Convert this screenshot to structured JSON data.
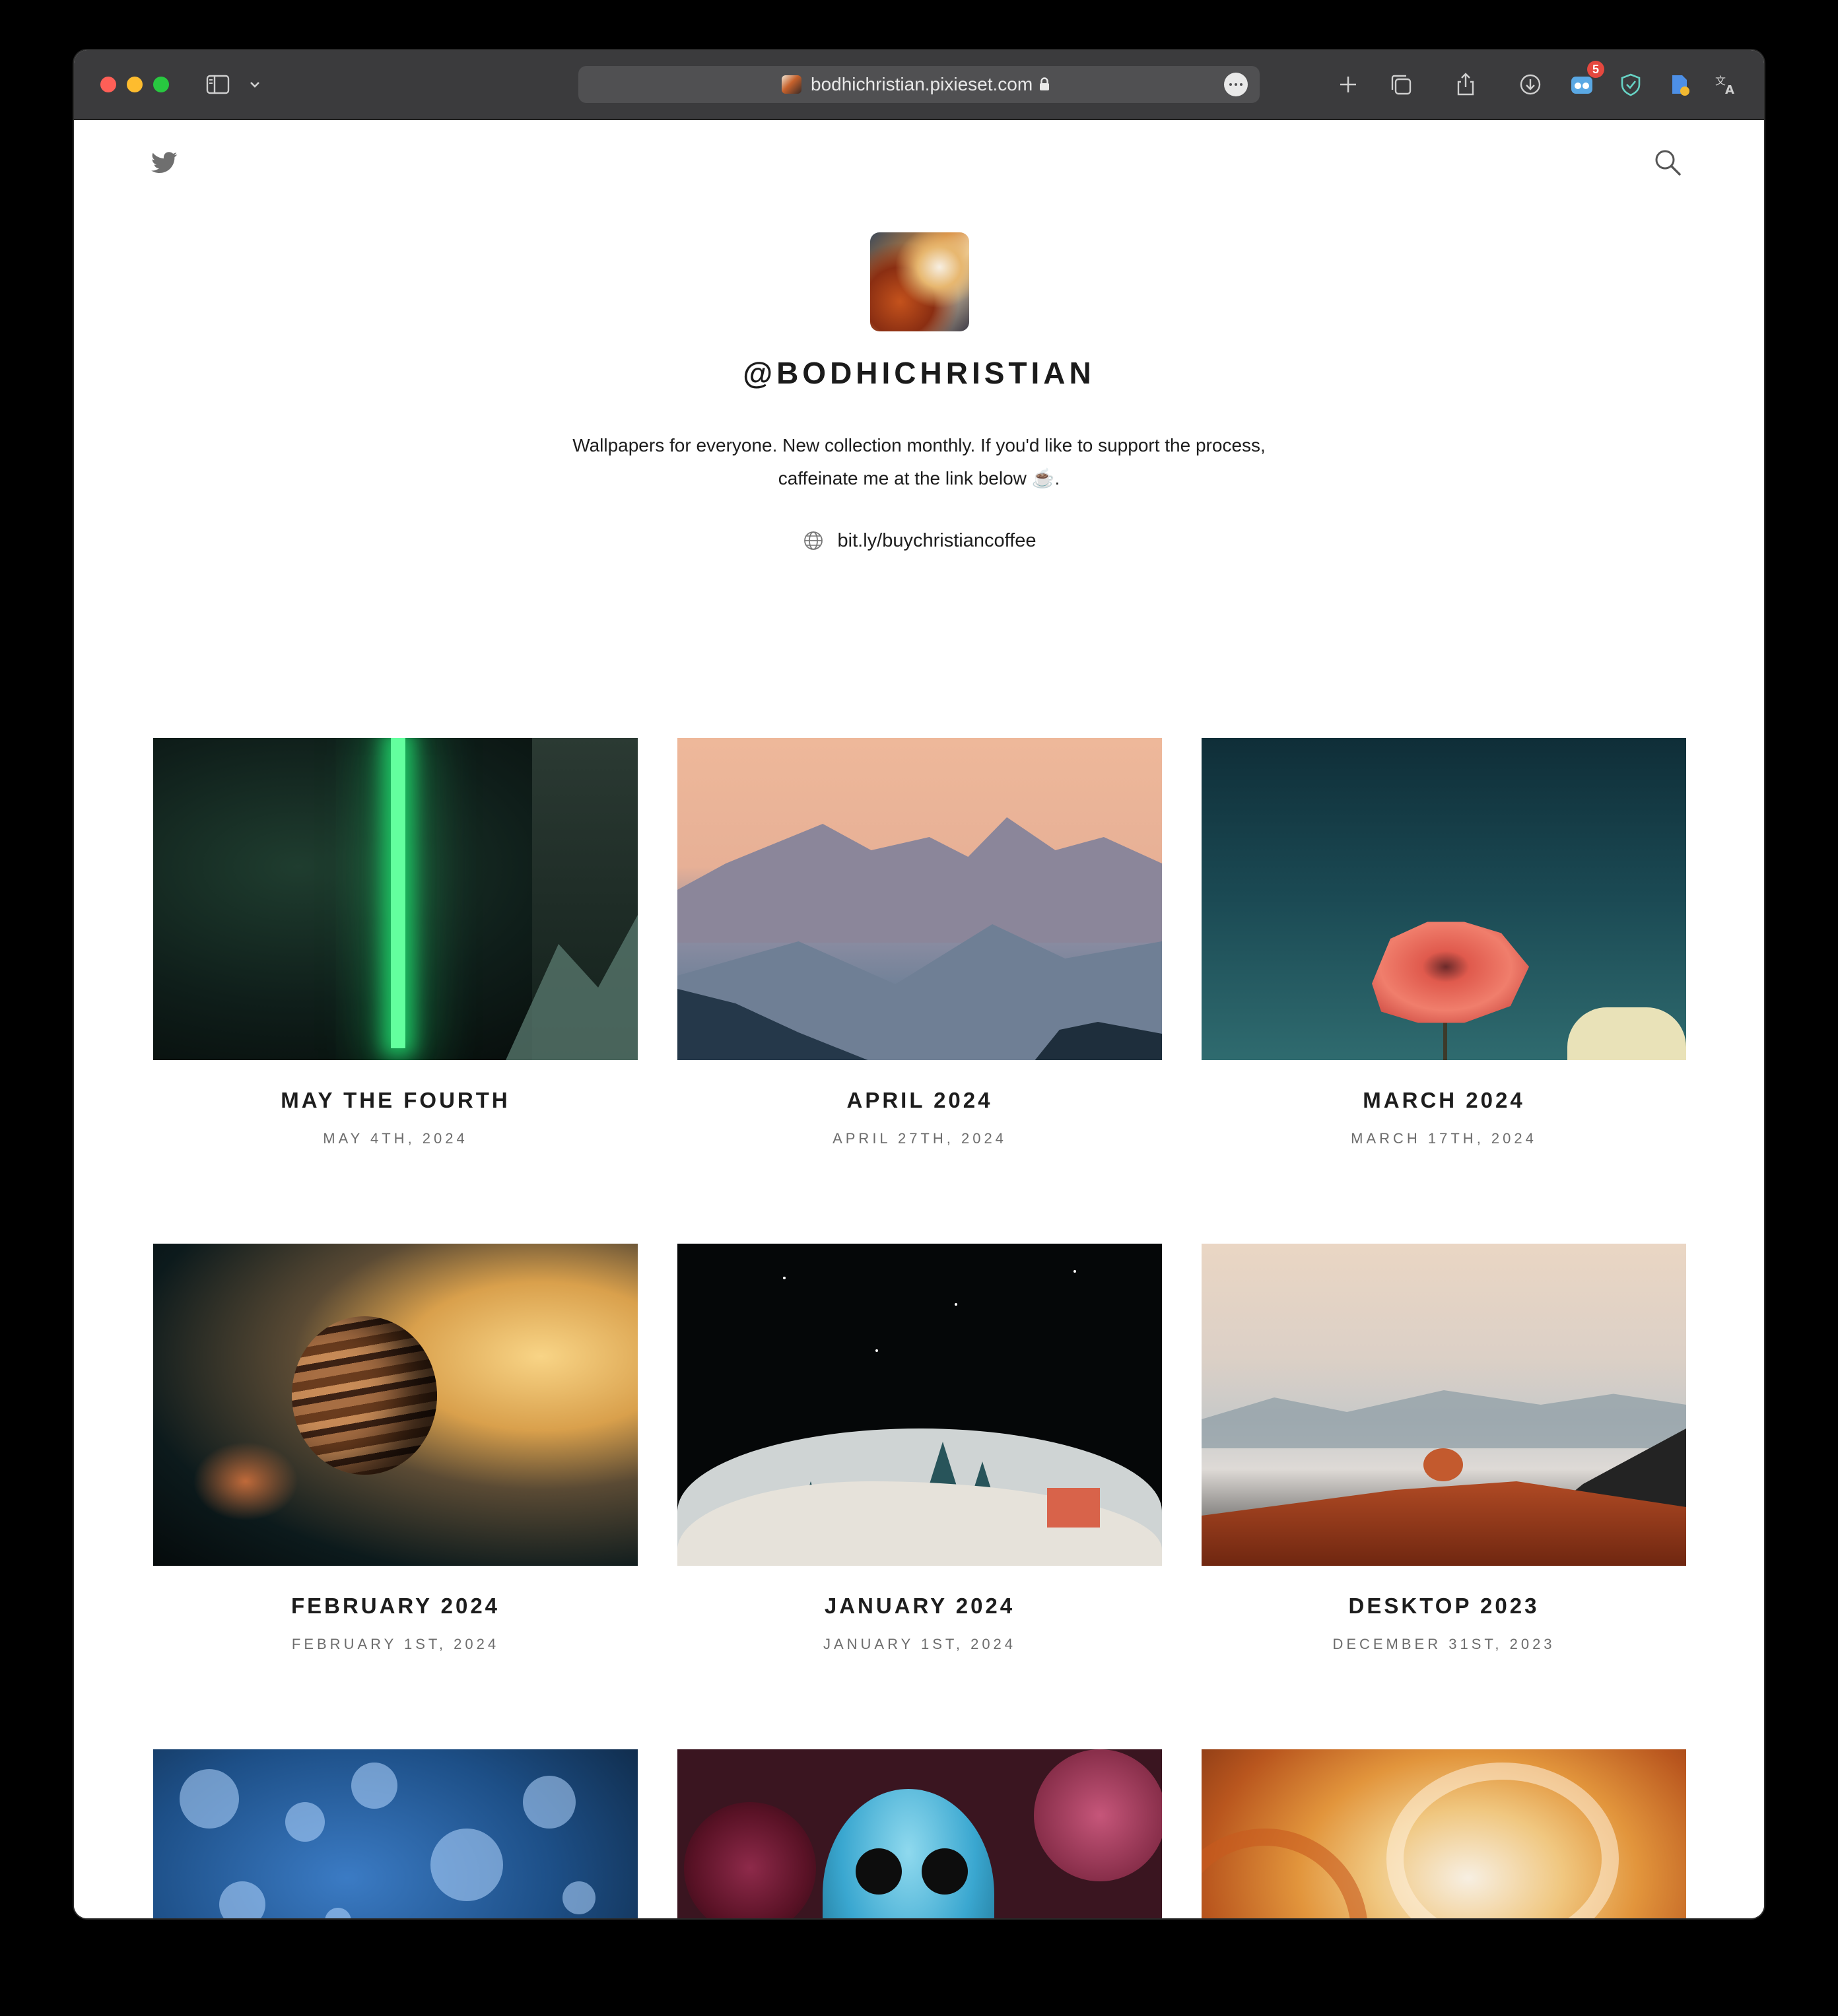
{
  "browser": {
    "url": "bodhichristian.pixieset.com",
    "notification_count": "5",
    "toolbar_icons": [
      "sidebar-icon",
      "chevron-down-icon",
      "plus-icon",
      "tabs-overview-icon",
      "share-icon",
      "download-icon",
      "extension-icon",
      "shield-check-icon",
      "extension2-icon",
      "translate-icon"
    ]
  },
  "header": {
    "left_icon": "twitter-icon",
    "right_icon": "search-icon"
  },
  "profile": {
    "name": "@BODHICHRISTIAN",
    "bio_line1": "Wallpapers for everyone. New collection monthly. If you'd like to support the process,",
    "bio_line2": "caffeinate me at the link below ☕.",
    "link": "bit.ly/buychristiancoffee"
  },
  "collections": [
    {
      "title": "MAY THE FOURTH",
      "date": "MAY 4TH, 2024"
    },
    {
      "title": "APRIL 2024",
      "date": "APRIL 27TH, 2024"
    },
    {
      "title": "MARCH 2024",
      "date": "MARCH 17TH, 2024"
    },
    {
      "title": "FEBRUARY 2024",
      "date": "FEBRUARY 1ST, 2024"
    },
    {
      "title": "JANUARY 2024",
      "date": "JANUARY 1ST, 2024"
    },
    {
      "title": "DESKTOP 2023",
      "date": "DECEMBER 31ST, 2023"
    },
    {
      "title": "",
      "date": ""
    },
    {
      "title": "",
      "date": ""
    },
    {
      "title": "",
      "date": ""
    }
  ],
  "colors": {
    "toolbar": "#3b3b3d",
    "page_background": "#ffffff",
    "text": "#1d1d1d",
    "muted": "#6d6d6d"
  }
}
